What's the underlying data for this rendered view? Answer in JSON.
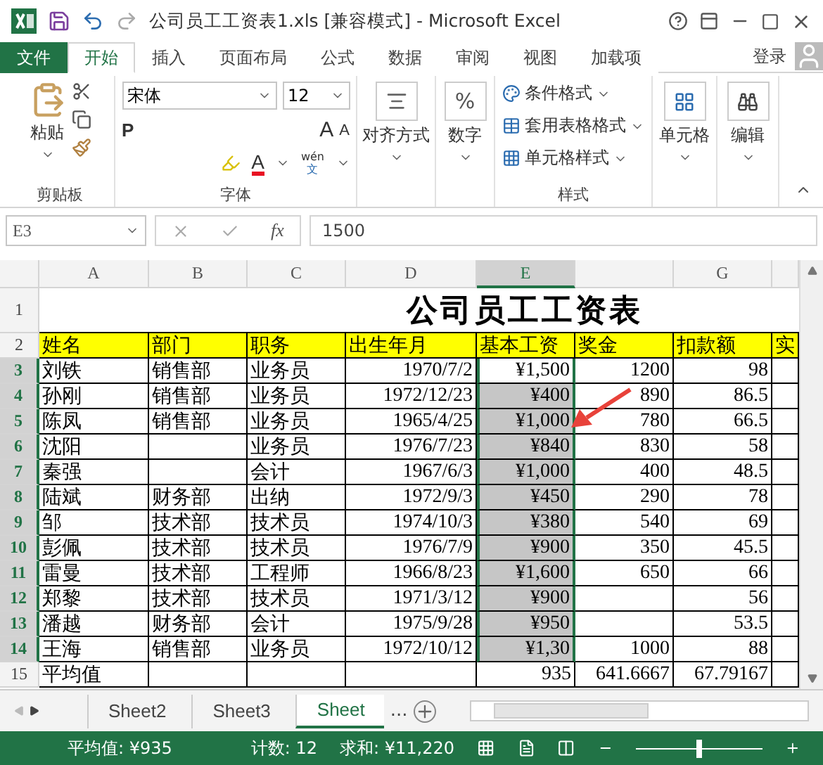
{
  "window": {
    "title": "公司员工工资表1.xls  [兼容模式] - Microsoft Excel"
  },
  "ribbon_tabs": [
    {
      "label": "文件",
      "kind": "file",
      "selected": false
    },
    {
      "label": "开始",
      "kind": "tab",
      "selected": true
    },
    {
      "label": "插入",
      "kind": "tab",
      "selected": false
    },
    {
      "label": "页面布局",
      "kind": "tab",
      "selected": false
    },
    {
      "label": "公式",
      "kind": "tab",
      "selected": false
    },
    {
      "label": "数据",
      "kind": "tab",
      "selected": false
    },
    {
      "label": "审阅",
      "kind": "tab",
      "selected": false
    },
    {
      "label": "视图",
      "kind": "tab",
      "selected": false
    },
    {
      "label": "加载项",
      "kind": "tab",
      "selected": false
    }
  ],
  "sign_in": "登录",
  "clipboard": {
    "paste": "粘贴",
    "label": "剪贴板"
  },
  "font": {
    "name": "宋体",
    "size": "12",
    "bold": "P",
    "grow": "A",
    "shrink": "A",
    "color_letter": "A",
    "phonetic_top": "wén",
    "phonetic_bottom": "文",
    "label": "字体"
  },
  "alignment": {
    "label": "对齐方式"
  },
  "number": {
    "symbol": "%",
    "label": "数字"
  },
  "styles": {
    "items": [
      "条件格式",
      "套用表格格式",
      "单元格样式"
    ],
    "label": "样式"
  },
  "cells": {
    "label": "单元格"
  },
  "editing": {
    "label": "编辑"
  },
  "formula_bar": {
    "name_box": "E3",
    "value": "1500",
    "fx": "fx"
  },
  "columns": [
    {
      "label": "A",
      "selected": false
    },
    {
      "label": "B",
      "selected": false
    },
    {
      "label": "C",
      "selected": false
    },
    {
      "label": "D",
      "selected": false
    },
    {
      "label": "E",
      "selected": true
    },
    {
      "selected": false
    },
    {
      "label": "G",
      "selected": false
    },
    {
      "selected": false
    }
  ],
  "title_row": {
    "number": "1",
    "text": "公司员工工资表"
  },
  "rows": [
    {
      "number": "2",
      "kind": "header",
      "selected": false,
      "cells": [
        {
          "text": "姓名"
        },
        {
          "text": "部门"
        },
        {
          "text": "职务"
        },
        {
          "text": "出生年月"
        },
        {
          "text": "基本工资"
        },
        {
          "text": "奖金"
        },
        {
          "text": "扣款额"
        },
        {
          "text": "实"
        }
      ]
    },
    {
      "number": "3",
      "kind": "data",
      "selected": true,
      "cells": [
        {
          "text": "刘铁"
        },
        {
          "text": "销售部"
        },
        {
          "text": "业务员"
        },
        {
          "text": "1970/7/2"
        },
        {
          "text": "¥1,500",
          "selected": false
        },
        {
          "text": "1200"
        },
        {
          "text": "98"
        },
        {}
      ]
    },
    {
      "number": "4",
      "kind": "data",
      "selected": true,
      "cells": [
        {
          "text": "孙刚"
        },
        {
          "text": "销售部"
        },
        {
          "text": "业务员"
        },
        {
          "text": "1972/12/23"
        },
        {
          "text": "¥400",
          "selected": true
        },
        {
          "text": "890"
        },
        {
          "text": "86.5"
        },
        {}
      ]
    },
    {
      "number": "5",
      "kind": "data",
      "selected": true,
      "cells": [
        {
          "text": "陈凤"
        },
        {
          "text": "销售部"
        },
        {
          "text": "业务员"
        },
        {
          "text": "1965/4/25"
        },
        {
          "text": "¥1,000",
          "selected": true
        },
        {
          "text": "780"
        },
        {
          "text": "66.5"
        },
        {}
      ]
    },
    {
      "number": "6",
      "kind": "data",
      "selected": true,
      "cells": [
        {
          "text": "沈阳"
        },
        {},
        {
          "text": "业务员"
        },
        {
          "text": "1976/7/23"
        },
        {
          "text": "¥840",
          "selected": true
        },
        {
          "text": "830"
        },
        {
          "text": "58"
        },
        {}
      ]
    },
    {
      "number": "7",
      "kind": "data",
      "selected": true,
      "cells": [
        {
          "text": "秦强"
        },
        {},
        {
          "text": "会计"
        },
        {
          "text": "1967/6/3"
        },
        {
          "text": "¥1,000",
          "selected": true
        },
        {
          "text": "400"
        },
        {
          "text": "48.5"
        },
        {}
      ]
    },
    {
      "number": "8",
      "kind": "data",
      "selected": true,
      "cells": [
        {
          "text": "陆斌"
        },
        {
          "text": "财务部"
        },
        {
          "text": "出纳"
        },
        {
          "text": "1972/9/3"
        },
        {
          "text": "¥450",
          "selected": true
        },
        {
          "text": "290"
        },
        {
          "text": "78"
        },
        {}
      ]
    },
    {
      "number": "9",
      "kind": "data",
      "selected": true,
      "cells": [
        {
          "text": "邹"
        },
        {
          "text": "技术部"
        },
        {
          "text": "技术员"
        },
        {
          "text": "1974/10/3"
        },
        {
          "text": "¥380",
          "selected": true
        },
        {
          "text": "540"
        },
        {
          "text": "69"
        },
        {}
      ]
    },
    {
      "number": "10",
      "kind": "data",
      "selected": true,
      "cells": [
        {
          "text": "彭佩"
        },
        {
          "text": "技术部"
        },
        {
          "text": "技术员"
        },
        {
          "text": "1976/7/9"
        },
        {
          "text": "¥900",
          "selected": true
        },
        {
          "text": "350"
        },
        {
          "text": "45.5"
        },
        {}
      ]
    },
    {
      "number": "11",
      "kind": "data",
      "selected": true,
      "cells": [
        {
          "text": "雷曼"
        },
        {
          "text": "技术部"
        },
        {
          "text": "工程师"
        },
        {
          "text": "1966/8/23"
        },
        {
          "text": "¥1,600",
          "selected": true
        },
        {
          "text": "650"
        },
        {
          "text": "66"
        },
        {}
      ]
    },
    {
      "number": "12",
      "kind": "data",
      "selected": true,
      "cells": [
        {
          "text": "郑黎"
        },
        {
          "text": "技术部"
        },
        {
          "text": "技术员"
        },
        {
          "text": "1971/3/12"
        },
        {
          "text": "¥900",
          "selected": true
        },
        {},
        {
          "text": "56"
        },
        {}
      ]
    },
    {
      "number": "13",
      "kind": "data",
      "selected": true,
      "cells": [
        {
          "text": "潘越"
        },
        {
          "text": "财务部"
        },
        {
          "text": "会计"
        },
        {
          "text": "1975/9/28"
        },
        {
          "text": "¥950",
          "selected": true
        },
        {},
        {
          "text": "53.5"
        },
        {}
      ]
    },
    {
      "number": "14",
      "kind": "data",
      "selected": true,
      "cells": [
        {
          "text": "王海"
        },
        {
          "text": "销售部"
        },
        {
          "text": "业务员"
        },
        {
          "text": "1972/10/12"
        },
        {
          "text": "¥1,30",
          "selected": true
        },
        {
          "text": "1000"
        },
        {
          "text": "88"
        },
        {}
      ]
    },
    {
      "number": "15",
      "kind": "data",
      "selected": false,
      "cells": [
        {
          "text": "平均值"
        },
        {},
        {},
        {},
        {
          "text": "935",
          "selected": false
        },
        {
          "text": "641.6667"
        },
        {
          "text": "67.79167"
        },
        {}
      ]
    }
  ],
  "sheet_tabs": [
    {
      "label": "Sheet2",
      "selected": false
    },
    {
      "label": "Sheet3",
      "selected": false
    },
    {
      "label": "Sheet",
      "selected": true
    }
  ],
  "more_sheets": "...",
  "status_bar": {
    "average": "平均值: ¥935",
    "count": "计数: 12",
    "sum": "求和: ¥11,220",
    "level": 0.5
  }
}
